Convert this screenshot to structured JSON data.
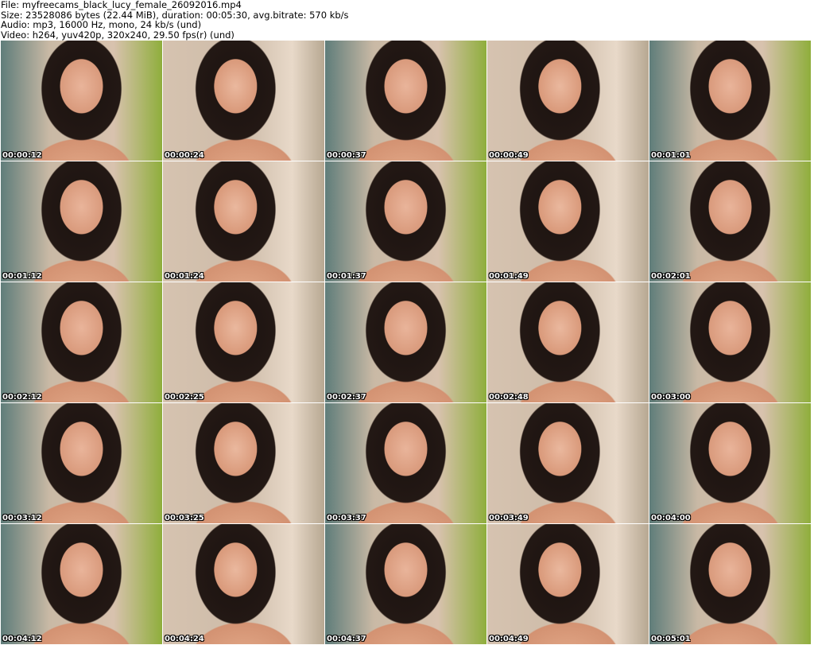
{
  "header": {
    "file": "File: myfreecams_black_lucy_female_26092016.mp4",
    "size": "Size: 23528086 bytes (22.44 MiB), duration: 00:05:30, avg.bitrate: 570 kb/s",
    "audio": "Audio: mp3, 16000 Hz, mono, 24 kb/s (und)",
    "video": "Video: h264, yuv420p, 320x240, 29.50 fps(r) (und)"
  },
  "thumbnails": [
    "00:00:12",
    "00:00:24",
    "00:00:37",
    "00:00:49",
    "00:01:01",
    "00:01:12",
    "00:01:24",
    "00:01:37",
    "00:01:49",
    "00:02:01",
    "00:02:12",
    "00:02:25",
    "00:02:37",
    "00:02:48",
    "00:03:00",
    "00:03:12",
    "00:03:25",
    "00:03:37",
    "00:03:49",
    "00:04:00",
    "00:04:12",
    "00:04:24",
    "00:04:37",
    "00:04:49",
    "00:05:01"
  ]
}
